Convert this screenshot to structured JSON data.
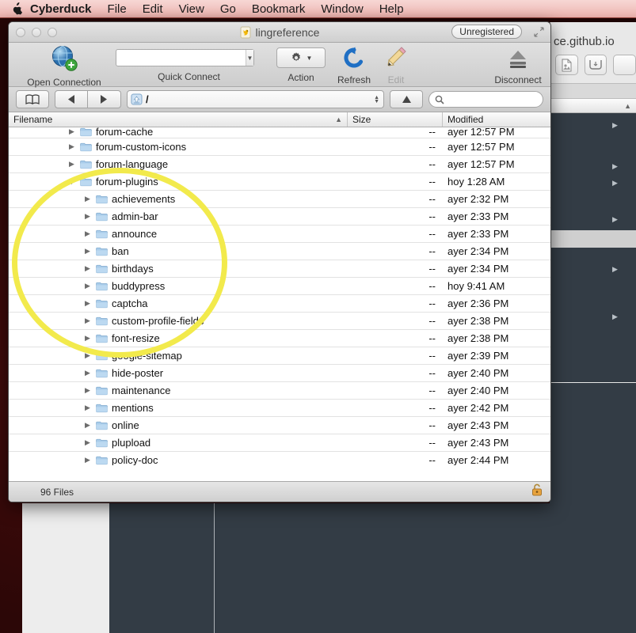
{
  "menubar": {
    "apple_icon": "apple-logo-icon",
    "items": [
      {
        "label": "Cyberduck",
        "bold": true
      },
      {
        "label": "File"
      },
      {
        "label": "Edit"
      },
      {
        "label": "View"
      },
      {
        "label": "Go"
      },
      {
        "label": "Bookmark"
      },
      {
        "label": "Window"
      },
      {
        "label": "Help"
      }
    ]
  },
  "window": {
    "title": "lingreference",
    "title_icon": "cyberduck-duck-icon",
    "badge": "Unregistered",
    "fullscreen_icon": "fullscreen-icon",
    "lights": [
      "close-button",
      "minimize-button",
      "zoom-button"
    ]
  },
  "toolbar": {
    "open_connection": {
      "label": "Open Connection",
      "icon": "globe-add-icon"
    },
    "quick_connect": {
      "label": "Quick Connect",
      "value": "",
      "placeholder": "",
      "icon": "dropdown-arrow-icon"
    },
    "action": {
      "label": "Action",
      "icon": "gear-icon"
    },
    "refresh": {
      "label": "Refresh",
      "icon": "refresh-arrow-icon"
    },
    "edit": {
      "label": "Edit",
      "icon": "pencil-icon",
      "disabled": true
    },
    "disconnect": {
      "label": "Disconnect",
      "icon": "eject-icon"
    }
  },
  "navbar": {
    "bookmark_icon": "book-icon",
    "back_icon": "back-arrow-icon",
    "forward_icon": "forward-arrow-icon",
    "path_icon": "drive-icon",
    "path_value": "/",
    "up_icon": "up-arrow-icon",
    "search_icon": "search-icon",
    "search_value": "",
    "search_placeholder": ""
  },
  "columns": {
    "filename": "Filename",
    "size": "Size",
    "modified": "Modified",
    "sort_indicator": "sort-ascending-icon"
  },
  "rows": [
    {
      "name": "forum-cache",
      "indent": 0,
      "state": "closed",
      "size": "--",
      "modified": "ayer 12:57 PM",
      "clipped_top": true
    },
    {
      "name": "forum-custom-icons",
      "indent": 0,
      "state": "closed",
      "size": "--",
      "modified": "ayer 12:57 PM"
    },
    {
      "name": "forum-language",
      "indent": 0,
      "state": "closed",
      "size": "--",
      "modified": "ayer 12:57 PM"
    },
    {
      "name": "forum-plugins",
      "indent": 0,
      "state": "open",
      "size": "--",
      "modified": "hoy 1:28 AM"
    },
    {
      "name": "achievements",
      "indent": 1,
      "state": "closed",
      "size": "--",
      "modified": "ayer 2:32 PM"
    },
    {
      "name": "admin-bar",
      "indent": 1,
      "state": "closed",
      "size": "--",
      "modified": "ayer 2:33 PM"
    },
    {
      "name": "announce",
      "indent": 1,
      "state": "closed",
      "size": "--",
      "modified": "ayer 2:33 PM"
    },
    {
      "name": "ban",
      "indent": 1,
      "state": "closed",
      "size": "--",
      "modified": "ayer 2:34 PM"
    },
    {
      "name": "birthdays",
      "indent": 1,
      "state": "closed",
      "size": "--",
      "modified": "ayer 2:34 PM"
    },
    {
      "name": "buddypress",
      "indent": 1,
      "state": "closed",
      "size": "--",
      "modified": "hoy 9:41 AM"
    },
    {
      "name": "captcha",
      "indent": 1,
      "state": "closed",
      "size": "--",
      "modified": "ayer 2:36 PM"
    },
    {
      "name": "custom-profile-fields",
      "indent": 1,
      "state": "closed",
      "size": "--",
      "modified": "ayer 2:38 PM"
    },
    {
      "name": "font-resize",
      "indent": 1,
      "state": "closed",
      "size": "--",
      "modified": "ayer 2:38 PM"
    },
    {
      "name": "google-sitemap",
      "indent": 1,
      "state": "closed",
      "size": "--",
      "modified": "ayer 2:39 PM"
    },
    {
      "name": "hide-poster",
      "indent": 1,
      "state": "closed",
      "size": "--",
      "modified": "ayer 2:40 PM"
    },
    {
      "name": "maintenance",
      "indent": 1,
      "state": "closed",
      "size": "--",
      "modified": "ayer 2:40 PM"
    },
    {
      "name": "mentions",
      "indent": 1,
      "state": "closed",
      "size": "--",
      "modified": "ayer 2:42 PM"
    },
    {
      "name": "online",
      "indent": 1,
      "state": "closed",
      "size": "--",
      "modified": "ayer 2:43 PM"
    },
    {
      "name": "plupload",
      "indent": 1,
      "state": "closed",
      "size": "--",
      "modified": "ayer 2:43 PM"
    },
    {
      "name": "policy-doc",
      "indent": 1,
      "state": "closed",
      "size": "--",
      "modified": "ayer 2:44 PM"
    }
  ],
  "statusbar": {
    "files": "96 Files",
    "lock_icon": "unlocked-padlock-icon"
  },
  "background_window": {
    "title": "ce.github.io",
    "buttons": [
      "page-icon",
      "tray-icon"
    ],
    "sort_indicator": "sort-ascending-icon"
  },
  "annotation": {
    "shape": "ellipse-highlight",
    "color": "#f2ea4c"
  },
  "colors": {
    "menubar_top": "#f7d7d4",
    "menubar_bottom": "#e3a9a5",
    "desktop": "#2d0707",
    "dark_panel": "#333c45",
    "light_panel": "#ededed",
    "annotation": "#f2ea4c"
  }
}
